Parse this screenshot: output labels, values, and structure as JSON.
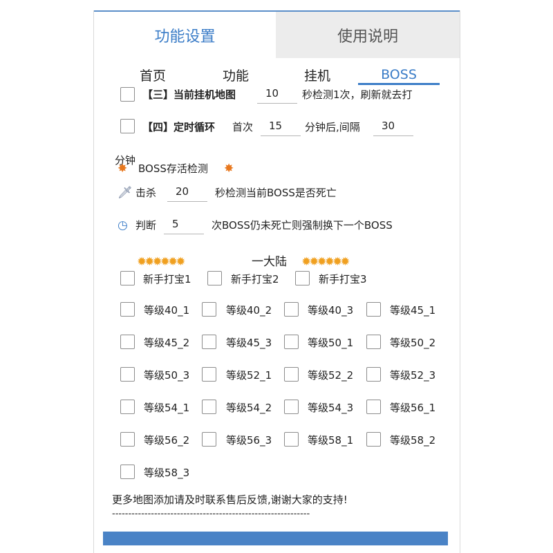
{
  "main_tabs": [
    {
      "label": "功能设置"
    },
    {
      "label": "使用说明"
    }
  ],
  "sub_tabs": [
    {
      "label": "首页"
    },
    {
      "label": "功能"
    },
    {
      "label": "挂机"
    },
    {
      "label": "BOSS"
    }
  ],
  "row3": {
    "label": "【三】当前挂机地图",
    "value": "10",
    "suffix": "秒检测1次，刷新就去打"
  },
  "row4": {
    "label": "【四】定时循环",
    "first_label": "首次",
    "first_value": "15",
    "mid_text": "分钟后,间隔",
    "interval_value": "30",
    "unit": "分钟"
  },
  "boss_check": {
    "title": "BOSS存活检测",
    "icon": "explosion-icon"
  },
  "kill": {
    "label": "击杀",
    "value": "20",
    "suffix": "秒检测当前BOSS是否死亡",
    "icon": "sword-icon"
  },
  "judge": {
    "label": "判断",
    "value": "5",
    "suffix": "次BOSS仍未死亡则强制换下一个BOSS",
    "icon": "clock-icon"
  },
  "continent": {
    "title": "一大陆",
    "icon": "star-icon"
  },
  "newbie_maps": [
    "新手打宝1",
    "新手打宝2",
    "新手打宝3"
  ],
  "level_maps": [
    "等级40_1",
    "等级40_2",
    "等级40_3",
    "等级45_1",
    "等级45_2",
    "等级45_3",
    "等级50_1",
    "等级50_2",
    "等级50_3",
    "等级52_1",
    "等级52_2",
    "等级52_3",
    "等级54_1",
    "等级54_2",
    "等级54_3",
    "等级56_1",
    "等级56_2",
    "等级56_3",
    "等级58_1",
    "等级58_2",
    "等级58_3"
  ],
  "footer_note": "更多地图添加请及时联系售后反馈,谢谢大家的支持!",
  "divider_text": "-------------------------------------------------------------",
  "colors": {
    "accent": "#3a7cc7",
    "bottom_bar": "#4a83c6",
    "inactive_tab_bg": "#ececec"
  }
}
